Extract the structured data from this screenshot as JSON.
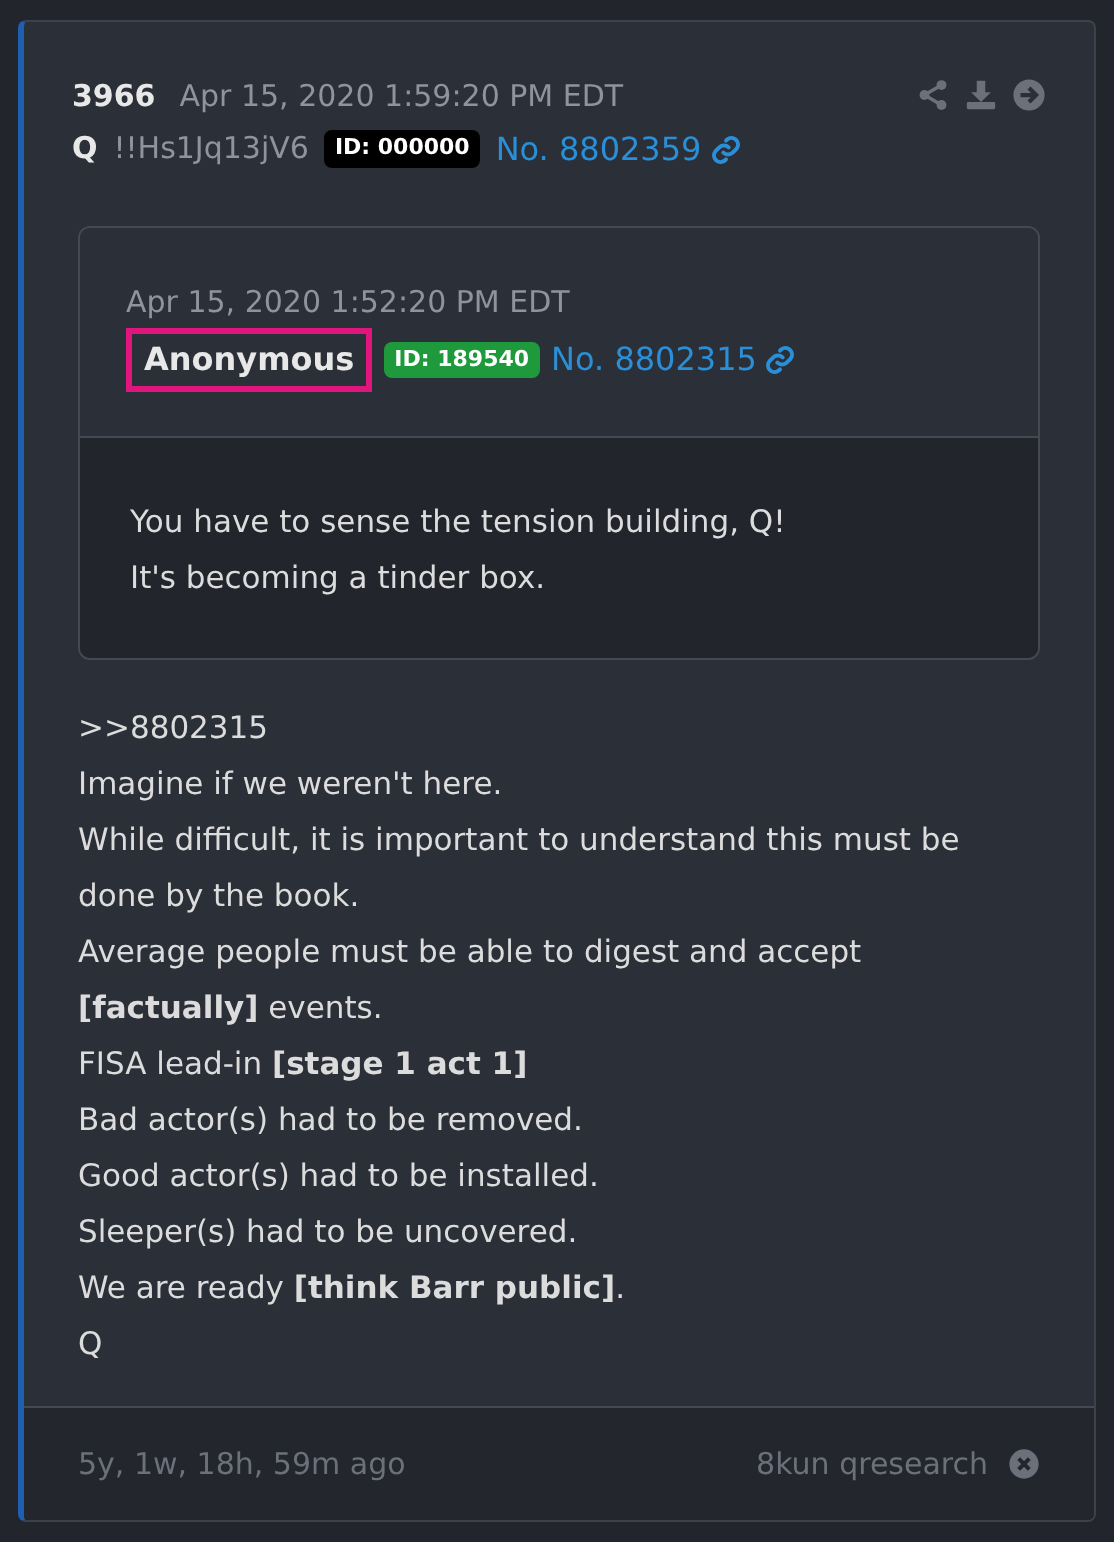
{
  "post": {
    "number": "3966",
    "timestamp": "Apr 15, 2020 1:59:20 PM EDT",
    "author": "Q",
    "tripcode": "!!Hs1Jq13jV6",
    "id_badge": {
      "text": "ID: 000000",
      "color": "#000000"
    },
    "post_link": "No. 8802359"
  },
  "quote": {
    "timestamp": "Apr 15, 2020 1:52:20 PM EDT",
    "author": "Anonymous",
    "author_highlighted": true,
    "id_badge": {
      "text": "ID: 189540",
      "color": "#1e9a3c"
    },
    "post_link": "No. 8802315",
    "lines": [
      "You have to sense the tension building, Q!",
      "It's becoming a tinder box."
    ]
  },
  "body_lines": [
    ">>8802315",
    "Imagine if we weren't here.",
    "While difficult, it is important to understand this must be done by the book.",
    "Average people must be able to digest and accept **[factually]** events.",
    "FISA lead-in **[stage 1 act 1]**",
    "Bad actor(s) had to be removed.",
    "Good actor(s) had to be installed.",
    "Sleeper(s) had to be uncovered.",
    "We are ready **[think Barr public]**.",
    "Q"
  ],
  "footer": {
    "age": "5y, 1w, 18h, 59m ago",
    "source": "8kun qresearch"
  }
}
